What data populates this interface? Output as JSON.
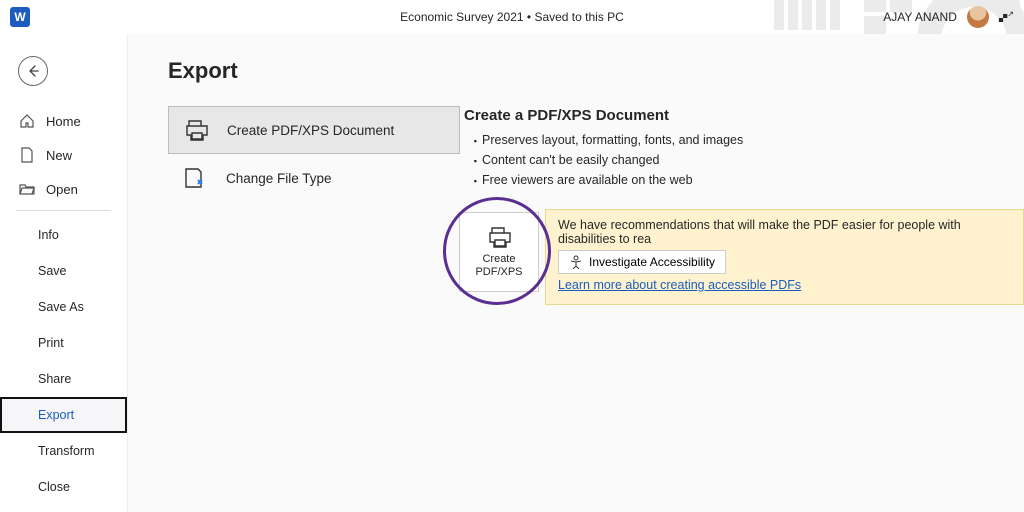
{
  "app": {
    "logo_letter": "W"
  },
  "title": {
    "doc_name": "Economic Survey 2021",
    "save_status": "Saved to this PC"
  },
  "user": {
    "name": "AJAY ANAND"
  },
  "nav": {
    "home": "Home",
    "new": "New",
    "open": "Open",
    "sub": [
      "Info",
      "Save",
      "Save As",
      "Print",
      "Share",
      "Export",
      "Transform",
      "Close"
    ]
  },
  "export": {
    "page_title": "Export",
    "opt_pdf": "Create PDF/XPS Document",
    "opt_filetype": "Change File Type"
  },
  "detail": {
    "heading": "Create a PDF/XPS Document",
    "bullets": [
      "Preserves layout, formatting, fonts, and images",
      "Content can't be easily changed",
      "Free viewers are available on the web"
    ],
    "button_line1": "Create",
    "button_line2": "PDF/XPS",
    "a11y_msg": "We have recommendations that will make the PDF easier for people with disabilities to rea",
    "investigate": "Investigate Accessibility",
    "learn": "Learn more about creating accessible PDFs"
  }
}
